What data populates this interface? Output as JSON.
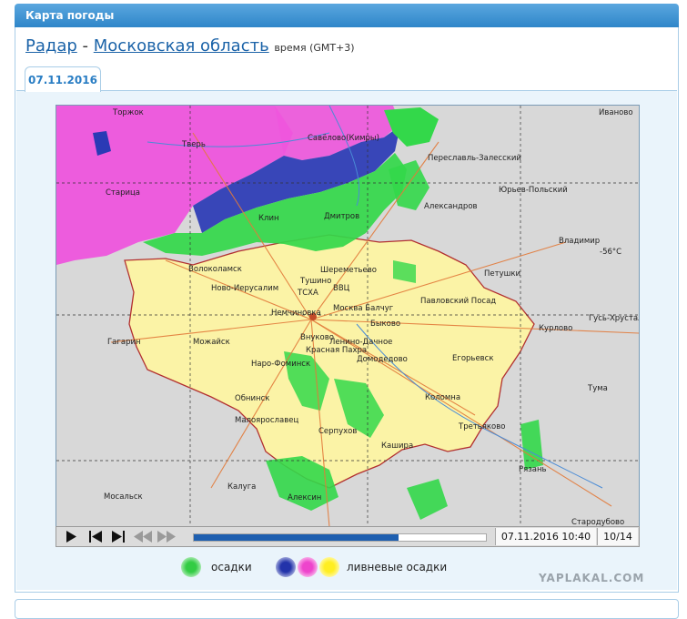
{
  "panel": {
    "title": "Карта погоды"
  },
  "heading": {
    "radar_link": "Радар",
    "separator": "-",
    "region_link": "Московская область",
    "time_note": "время (GMT+3)"
  },
  "tab": {
    "label": "07.11.2016"
  },
  "map": {
    "cities": [
      "Торжок",
      "Тверь",
      "Старица",
      "Савёлово(Кимры)",
      "Переславль-Залесский",
      "Иваново",
      "Юрьев-Польский",
      "Александров",
      "Клин",
      "Дмитров",
      "Владимир",
      "Волоколамск",
      "Шереметьево",
      "Петушки",
      "Тушино",
      "Ново-Иерусалим",
      "ТСХА",
      "ВВЦ",
      "Павловский Посад",
      "Немчиновка",
      "Москва Балчуг",
      "Быково",
      "Гусь-Хрустальный",
      "Внуково",
      "Ленино-Дачное",
      "Курлово",
      "Гагарин",
      "Можайск",
      "Красная Пахра",
      "Домодедово",
      "Егорьевск",
      "Наро-Фоминск",
      "Тума",
      "Обнинск",
      "Коломна",
      "Малоярославец",
      "Серпухов",
      "Третьяково",
      "Кашира",
      "Рязань",
      "Калуга",
      "Алексин",
      "Мосальск",
      "Стародубово"
    ],
    "temperature": "-56°C"
  },
  "player": {
    "progress": 0.7,
    "datetime": "07.11.2016 10:40",
    "frame": "10/14",
    "buttons": [
      "play",
      "step-back",
      "step-forward",
      "rewind",
      "fast-forward"
    ]
  },
  "legend": {
    "precip_label": "осадки",
    "shower_label": "ливневые осадки",
    "colors": {
      "precip": "#33cc44",
      "shower_blue": "#2233aa",
      "shower_magenta": "#ee44cc",
      "shower_yellow": "#ffee22"
    }
  },
  "watermark": "YAPLAKAL.COM"
}
